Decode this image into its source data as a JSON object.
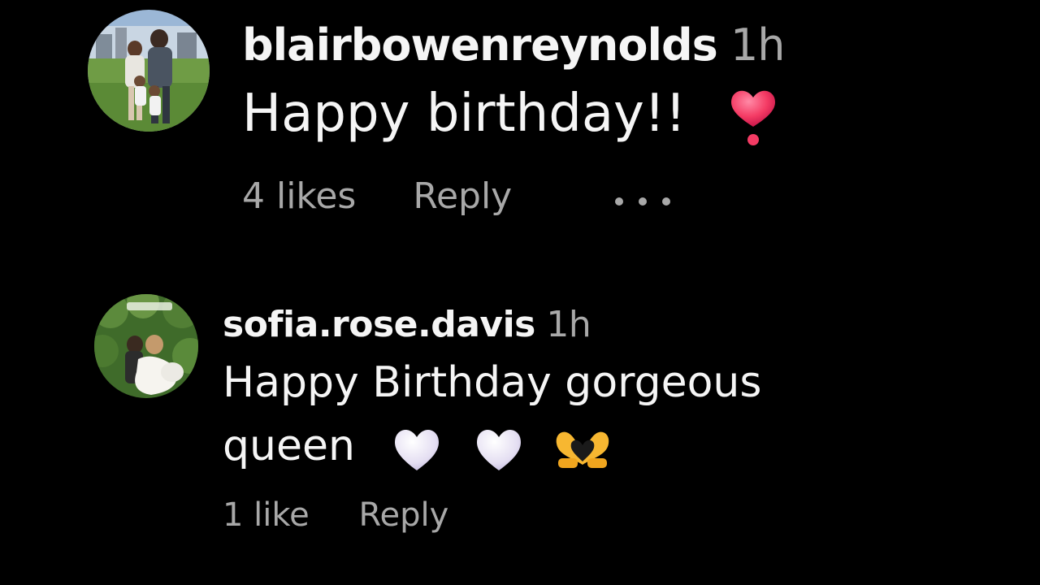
{
  "comments": [
    {
      "username": "blairbowenreynolds",
      "time": "1h",
      "text": "Happy birthday!!",
      "emojis": [
        "heavy-heart-exclamation-emoji"
      ],
      "likes_label": "4 likes",
      "reply_label": "Reply",
      "more_label": "•••"
    },
    {
      "username": "sofia.rose.davis",
      "time": "1h",
      "text": "Happy Birthday gorgeous queen",
      "emojis": [
        "white-heart-emoji",
        "white-heart-emoji",
        "heart-hands-emoji"
      ],
      "likes_label": "1 like",
      "reply_label": "Reply"
    }
  ],
  "colors": {
    "background": "#000000",
    "primary_text": "#f5f5f5",
    "secondary_text": "#a8a8a8",
    "heart_red": "#f43b64"
  }
}
